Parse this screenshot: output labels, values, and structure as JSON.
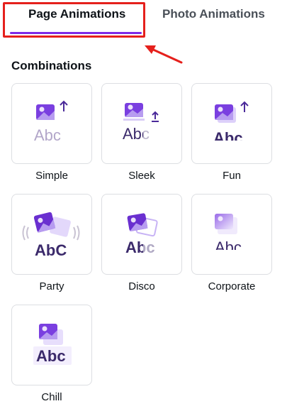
{
  "tabs": [
    {
      "label": "Page Animations",
      "active": true
    },
    {
      "label": "Photo Animations",
      "active": false
    }
  ],
  "section_title": "Combinations",
  "animations": [
    {
      "label": "Simple",
      "sample_text": "Abc"
    },
    {
      "label": "Sleek",
      "sample_text": "Abc"
    },
    {
      "label": "Fun",
      "sample_text": "Abc"
    },
    {
      "label": "Party",
      "sample_text": "AbC"
    },
    {
      "label": "Disco",
      "sample_text": "Abc"
    },
    {
      "label": "Corporate",
      "sample_text": "Abc"
    },
    {
      "label": "Chill",
      "sample_text": "Abc"
    }
  ],
  "colors": {
    "accent": "#7d2ae8",
    "icon_dark": "#6a2fd0",
    "icon_light": "#c7b3f5",
    "text_dark": "#3b2a6b",
    "annotation": "#e5201c"
  }
}
